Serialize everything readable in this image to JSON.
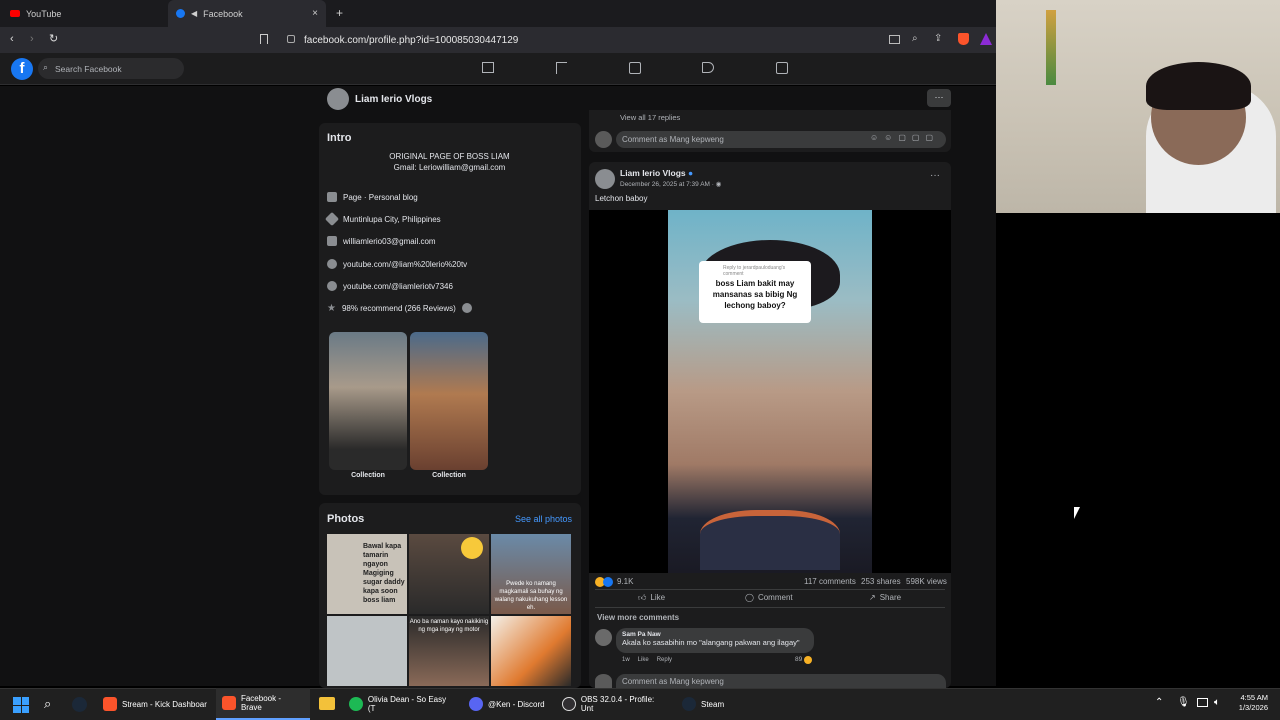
{
  "tabs": [
    {
      "label": "YouTube"
    },
    {
      "label": "Facebook"
    }
  ],
  "address": {
    "url": "facebook.com/profile.php?id=100085030447129"
  },
  "fb": {
    "search_placeholder": "Search Facebook",
    "page_name": "Liam Ierio Vlogs"
  },
  "intro": {
    "title": "Intro",
    "bio_line1": "ORIGINAL PAGE OF BOSS LIAM",
    "bio_line2": "Gmail: Leriowilliam@gmail.com",
    "rows": [
      {
        "icon": "flag-icon",
        "text": "Page · Personal blog"
      },
      {
        "icon": "location-icon",
        "text": "Muntinlupa City, Philippines"
      },
      {
        "icon": "mail-icon",
        "text": "williamlerio03@gmail.com"
      },
      {
        "icon": "link-icon",
        "text": "youtube.com/@liam%20lerio%20tv"
      },
      {
        "icon": "link-icon",
        "text": "youtube.com/@liamleriotv7346"
      },
      {
        "icon": "star-icon",
        "text": "98% recommend (266 Reviews)"
      }
    ],
    "collections": [
      {
        "label": "Collection"
      },
      {
        "label": "Collection"
      }
    ]
  },
  "photos": {
    "title": "Photos",
    "see_all": "See all photos",
    "captions": [
      "Bawal kapa tamarin ngayon Magiging sugar daddy kapa soon boss liam",
      "",
      "Pwede ko namang magkamali sa buhay ng walang nakukuhang lesson eh.",
      "",
      "Ano ba naman kayo nakikinig ng mga ingay ng motor",
      ""
    ]
  },
  "post": {
    "top_view_replies": "View all 17 replies",
    "comment_as": "Comment as Mang kepweng",
    "author": "Liam Ierio Vlogs",
    "date": "December 26, 2025 at 7:39 AM ·",
    "caption": "Letchon baboy",
    "video_reply_to": "Reply to jerardpauloduang's comment",
    "video_question": "boss Liam bakit may mansanas sa bibig Ng lechong baboy?",
    "reactions": "9.1K",
    "comments": "117 comments",
    "shares": "253 shares",
    "views": "598K views",
    "like": "Like",
    "comment": "Comment",
    "share": "Share",
    "view_more": "View more comments",
    "commenter": "Sam Pa Naw",
    "comment_text": "Akala ko sasabihin mo \"alangang pakwan ang ilagay\"",
    "comment_age": "1w",
    "comment_like": "Like",
    "comment_reply": "Reply",
    "comment_reacts": "89",
    "comment_as_bottom": "Comment as Mang kepweng"
  },
  "taskbar": {
    "items": [
      {
        "label": "Stream - Kick Dashboar"
      },
      {
        "label": "Facebook - Brave"
      },
      {
        "label": "Olivia Dean - So Easy (T"
      },
      {
        "label": "@Ken - Discord"
      },
      {
        "label": "OBS 32.0.4 - Profile: Unt"
      },
      {
        "label": "Steam"
      }
    ],
    "time": "4:55 AM",
    "date": "1/3/2026"
  },
  "colors": {
    "fb_blue": "#1877f2",
    "link": "#4599ff",
    "bg": "#111112",
    "card": "#1c1c1d"
  }
}
